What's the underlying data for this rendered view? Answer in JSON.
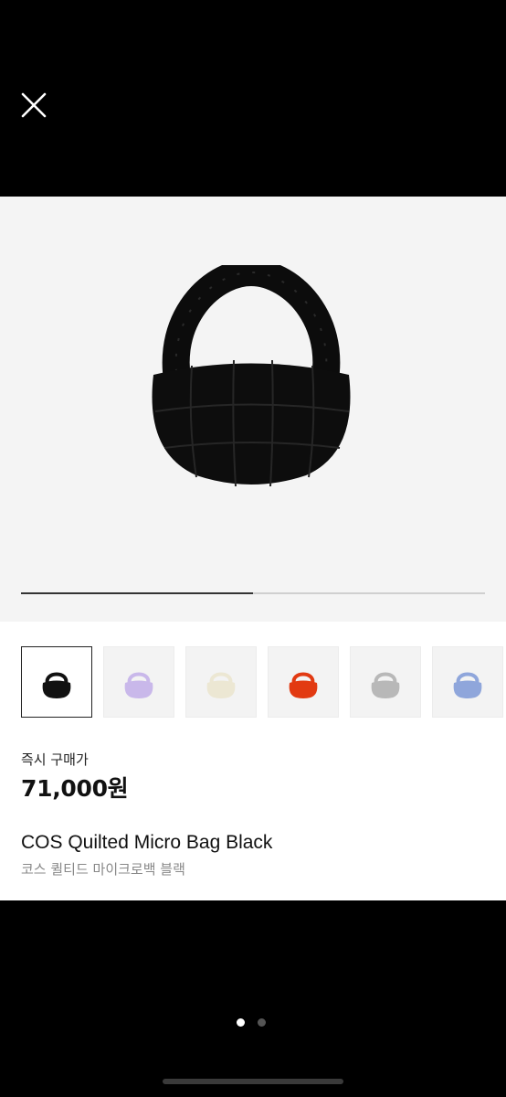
{
  "header": {
    "close_icon": "close-icon"
  },
  "gallery": {
    "background": "#f4f4f4",
    "main_image": "black-quilted-bag",
    "progress_fraction": 0.5
  },
  "thumbnails": [
    {
      "color": "#111111",
      "selected": true
    },
    {
      "color": "#c9b8ea",
      "selected": false
    },
    {
      "color": "#ece7d3",
      "selected": false
    },
    {
      "color": "#e23a12",
      "selected": false
    },
    {
      "color": "#b8b8b8",
      "selected": false
    },
    {
      "color": "#8fa6db",
      "selected": false
    }
  ],
  "product": {
    "price_label": "즉시 구매가",
    "price": "71,000원",
    "name_en": "COS Quilted Micro Bag Black",
    "name_ko": "코스 퀼티드 마이크로백 블랙"
  },
  "pager": {
    "count": 2,
    "active": 0
  }
}
